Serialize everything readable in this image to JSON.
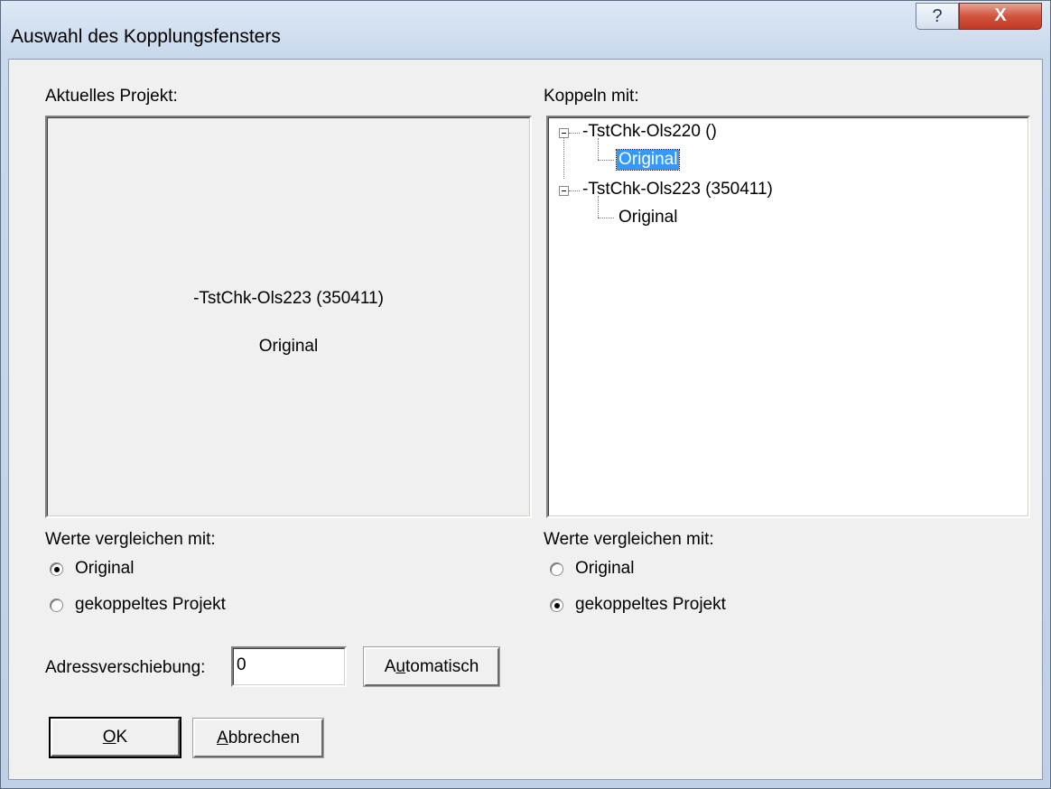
{
  "window": {
    "title": "Auswahl des Kopplungsfensters",
    "help_label": "?",
    "close_label": "X"
  },
  "left": {
    "heading": "Aktuelles Projekt:",
    "project_name": "-TstChk-Ols223 (350411)",
    "version_name": "Original",
    "compare_label": "Werte vergleichen mit:",
    "radio_original": "Original",
    "radio_coupled": "gekoppeltes Projekt",
    "selected": "Original"
  },
  "right": {
    "heading": "Koppeln mit:",
    "tree": [
      {
        "label": "-TstChk-Ols220 ()",
        "children": [
          {
            "label": "Original",
            "selected": true
          }
        ]
      },
      {
        "label": "-TstChk-Ols223 (350411)",
        "children": [
          {
            "label": "Original",
            "selected": false
          }
        ]
      }
    ],
    "compare_label": "Werte vergleichen mit:",
    "radio_original": "Original",
    "radio_coupled": "gekoppeltes Projekt",
    "selected": "gekoppeltes Projekt"
  },
  "address": {
    "label": "Adressverschiebung:",
    "value": "0",
    "auto_button_pre": "A",
    "auto_button_ul": "u",
    "auto_button_post": "tomatisch"
  },
  "buttons": {
    "ok_ul": "O",
    "ok_post": "K",
    "cancel_ul": "A",
    "cancel_post": "bbrechen"
  }
}
